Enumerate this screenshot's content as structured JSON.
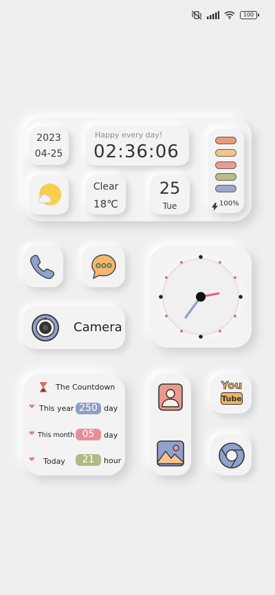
{
  "status_bar": {
    "battery": "100",
    "icons": [
      "vibrate-icon",
      "signal-icon",
      "wifi-icon",
      "battery-icon"
    ]
  },
  "widget_top": {
    "year": "2023",
    "date": "04-25",
    "greeting": "Happy every day!",
    "time": "02:36:06",
    "weather_condition": "Clear",
    "temperature": "18℃",
    "day_number": "25",
    "weekday": "Tue",
    "battery_percent": "100%",
    "bar_colors": [
      "#e99a7b",
      "#f2c58c",
      "#e99a9b",
      "#b7bd86",
      "#9aa8c9"
    ]
  },
  "apps": {
    "camera_label": "Camera",
    "youtube_top": "You",
    "youtube_bottom": "Tube"
  },
  "countdown": {
    "title": "The Countdown",
    "rows": [
      {
        "label": "This year",
        "value": "250",
        "unit": "day",
        "color": "#8f9fc4"
      },
      {
        "label": "This month",
        "value": "05",
        "unit": "day",
        "color": "#e68f9b"
      },
      {
        "label": "Today",
        "value": "21",
        "unit": "hour",
        "color": "#b2ba84"
      }
    ]
  },
  "colors": {
    "background": "#efefef",
    "accent_red": "#e66173",
    "clock_minute": "#8fa1cc"
  }
}
